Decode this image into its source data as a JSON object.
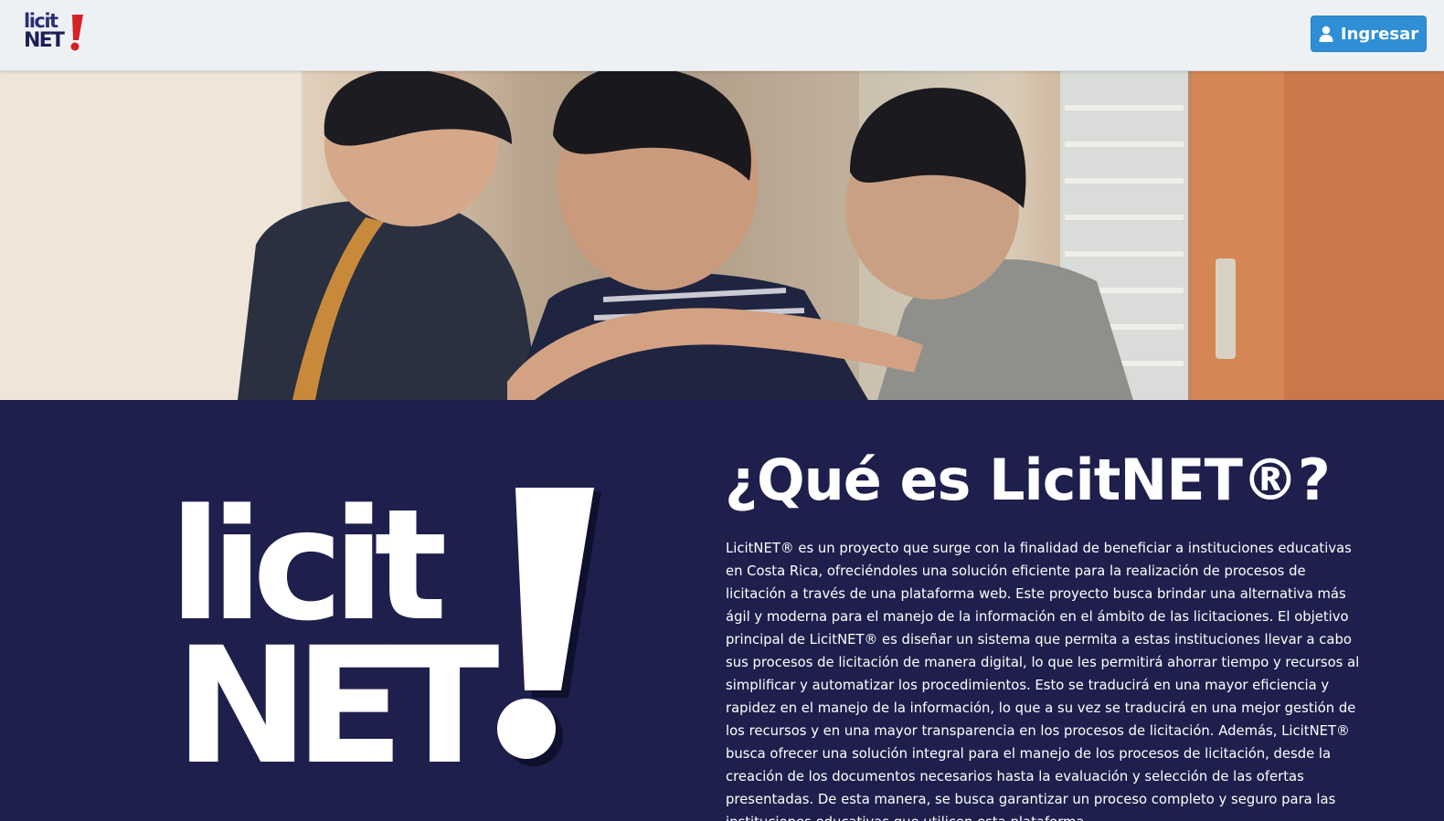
{
  "header": {
    "logo": {
      "line1": "licit",
      "line2": "NET",
      "accent": "!",
      "colors": {
        "text": "#2a2f73",
        "accent": "#d42027"
      }
    },
    "login_button": {
      "icon": "user-icon",
      "label": "Ingresar",
      "color": "#2f8fd6"
    }
  },
  "hero": {
    "image": "students-hallway-photo"
  },
  "about": {
    "logo": {
      "line1": "licit",
      "line2": "NET",
      "accent": "!"
    },
    "title": "¿Qué es LicitNET®?",
    "body": "LicitNET® es un proyecto que surge con la finalidad de beneficiar a instituciones educativas en Costa Rica, ofreciéndoles una solución eficiente para la realización de procesos de licitación a través de una plataforma web. Este proyecto busca brindar una alternativa más ágil y moderna para el manejo de la información en el ámbito de las licitaciones. El objetivo principal de LicitNET® es diseñar un sistema que permita a estas instituciones llevar a cabo sus procesos de licitación de manera digital, lo que les permitirá ahorrar tiempo y recursos al simplificar y automatizar los procedimientos. Esto se traducirá en una mayor eficiencia y rapidez en el manejo de la información, lo que a su vez se traducirá en una mejor gestión de los recursos y en una mayor transparencia en los procesos de licitación. Además, LicitNET® busca ofrecer una solución integral para el manejo de los procesos de licitación, desde la creación de los documentos necesarios hasta la evaluación y selección de las ofertas presentadas. De esta manera, se busca garantizar un proceso completo y seguro para las instituciones educativas que utilicen esta plataforma.",
    "background": "#1f1f4d"
  }
}
